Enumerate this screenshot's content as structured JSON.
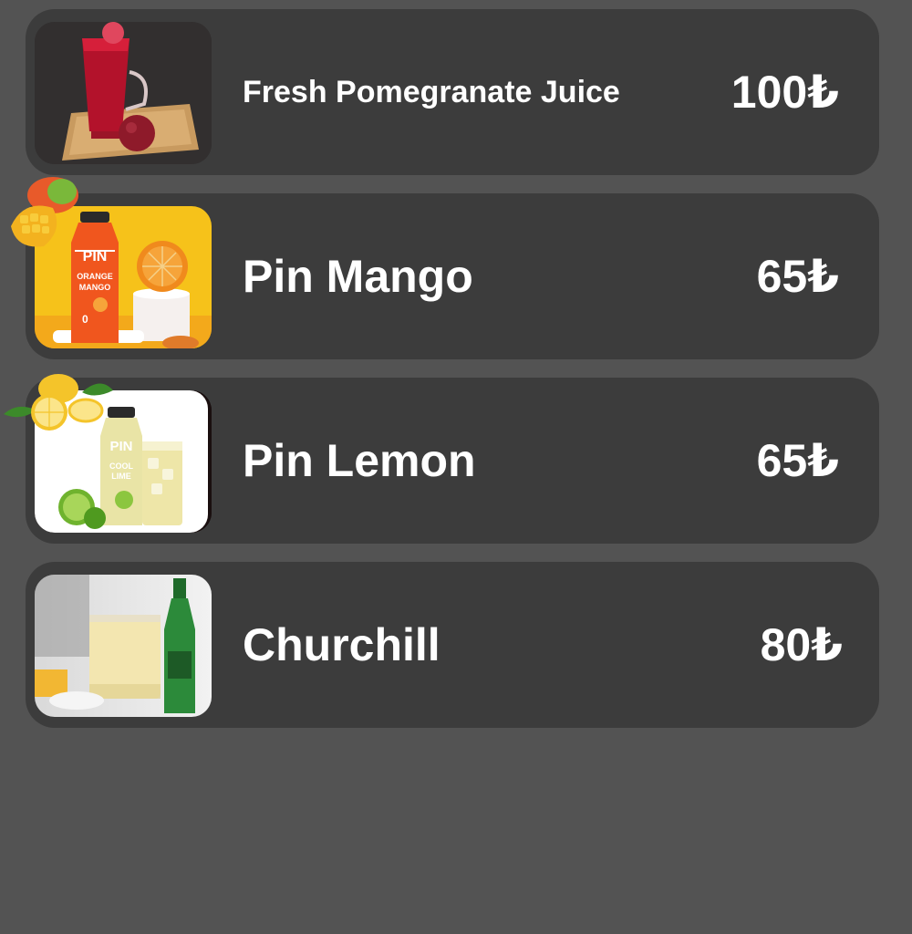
{
  "menu": {
    "items": [
      {
        "name": "Fresh Pomegranate Juice",
        "price": "100₺",
        "image": "pomegranate-juice-photo"
      },
      {
        "name": "Pin Mango",
        "price": "65₺",
        "image": "pin-orange-mango-bottle-photo",
        "bottle_brand": "PIN",
        "bottle_flavor_1": "ORANGE",
        "bottle_flavor_2": "MANGO"
      },
      {
        "name": "Pin Lemon",
        "price": "65₺",
        "image": "pin-cool-lime-bottle-photo",
        "bottle_brand": "PIN",
        "bottle_flavor_1": "COOL",
        "bottle_flavor_2": "LIME"
      },
      {
        "name": "Churchill",
        "price": "80₺",
        "image": "churchill-drink-photo"
      }
    ]
  },
  "colors": {
    "page_background": "#535353",
    "card_background": "#3c3c3c",
    "text": "#ffffff"
  }
}
